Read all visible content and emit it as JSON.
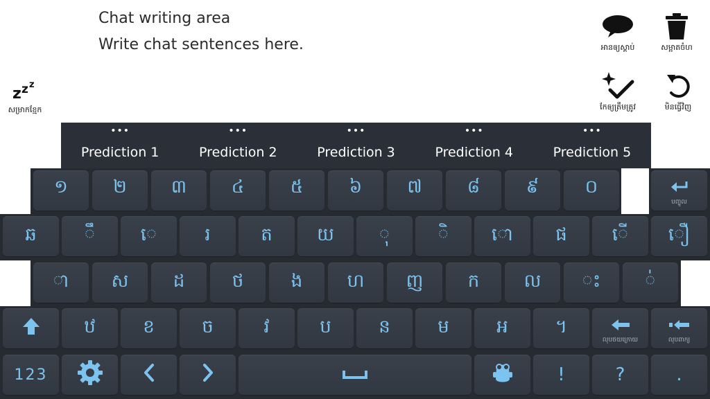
{
  "chat": {
    "title": "Chat writing area",
    "text": "Write chat sentences here."
  },
  "tools": {
    "sleep": {
      "icon": "zzz-icon",
      "label": "សម្រាកខ្មែក"
    },
    "speak": {
      "icon": "speech-bubble-icon",
      "label": "អានឲ្យស្ដាប់"
    },
    "clear": {
      "icon": "trash-icon",
      "label": "សម្អាតចំហ"
    },
    "correct": {
      "icon": "sparkle-check-icon",
      "label": "កែឲ្យត្រឹមត្រូវ"
    },
    "undo": {
      "icon": "undo-icon",
      "label": "មិនធ្វើវិញ"
    }
  },
  "predictions": [
    "Prediction 1",
    "Prediction 2",
    "Prediction 3",
    "Prediction 4",
    "Prediction 5"
  ],
  "prediction_dots": "•••",
  "keyboard": {
    "row1": [
      "១",
      "២",
      "៣",
      "៤",
      "៥",
      "៦",
      "៧",
      "៨",
      "៩",
      "០"
    ],
    "enter": {
      "icon": "enter-arrow-icon",
      "label": "បញ្ចូល"
    },
    "row2": [
      "ឆ",
      "ឹ",
      "េ",
      "រ",
      "ត",
      "យ",
      "ុ",
      "ិ",
      "ោ",
      "ផ",
      "ើ",
      "ឿ"
    ],
    "row3": [
      "ា",
      "ស",
      "ដ",
      "ថ",
      "ង",
      "ហ",
      "ញ",
      "ក",
      "ល",
      "ះ",
      "់"
    ],
    "shift": {
      "icon": "shift-arrow-icon"
    },
    "row4": [
      "ឋ",
      "ខ",
      "ច",
      "វ",
      "ប",
      "ន",
      "ម",
      "អ",
      "។"
    ],
    "backspace": {
      "icon": "backspace-arrow-icon",
      "label": "លុបថយក្រោយ"
    },
    "delete_word": {
      "icon": "delete-word-icon",
      "label": "លុបពាក្យ"
    },
    "numbers_label": "123",
    "settings": {
      "icon": "gear-icon"
    },
    "left": {
      "icon": "chevron-left-icon"
    },
    "right": {
      "icon": "chevron-right-icon"
    },
    "space": {
      "icon": "space-bar-icon"
    },
    "emoji": {
      "icon": "mascot-icon"
    },
    "exclaim": "!",
    "question": "?",
    "period": "."
  },
  "colors": {
    "key_text": "#7cc3ef",
    "key_bg": "#363c46",
    "board_bg": "#262b32"
  }
}
